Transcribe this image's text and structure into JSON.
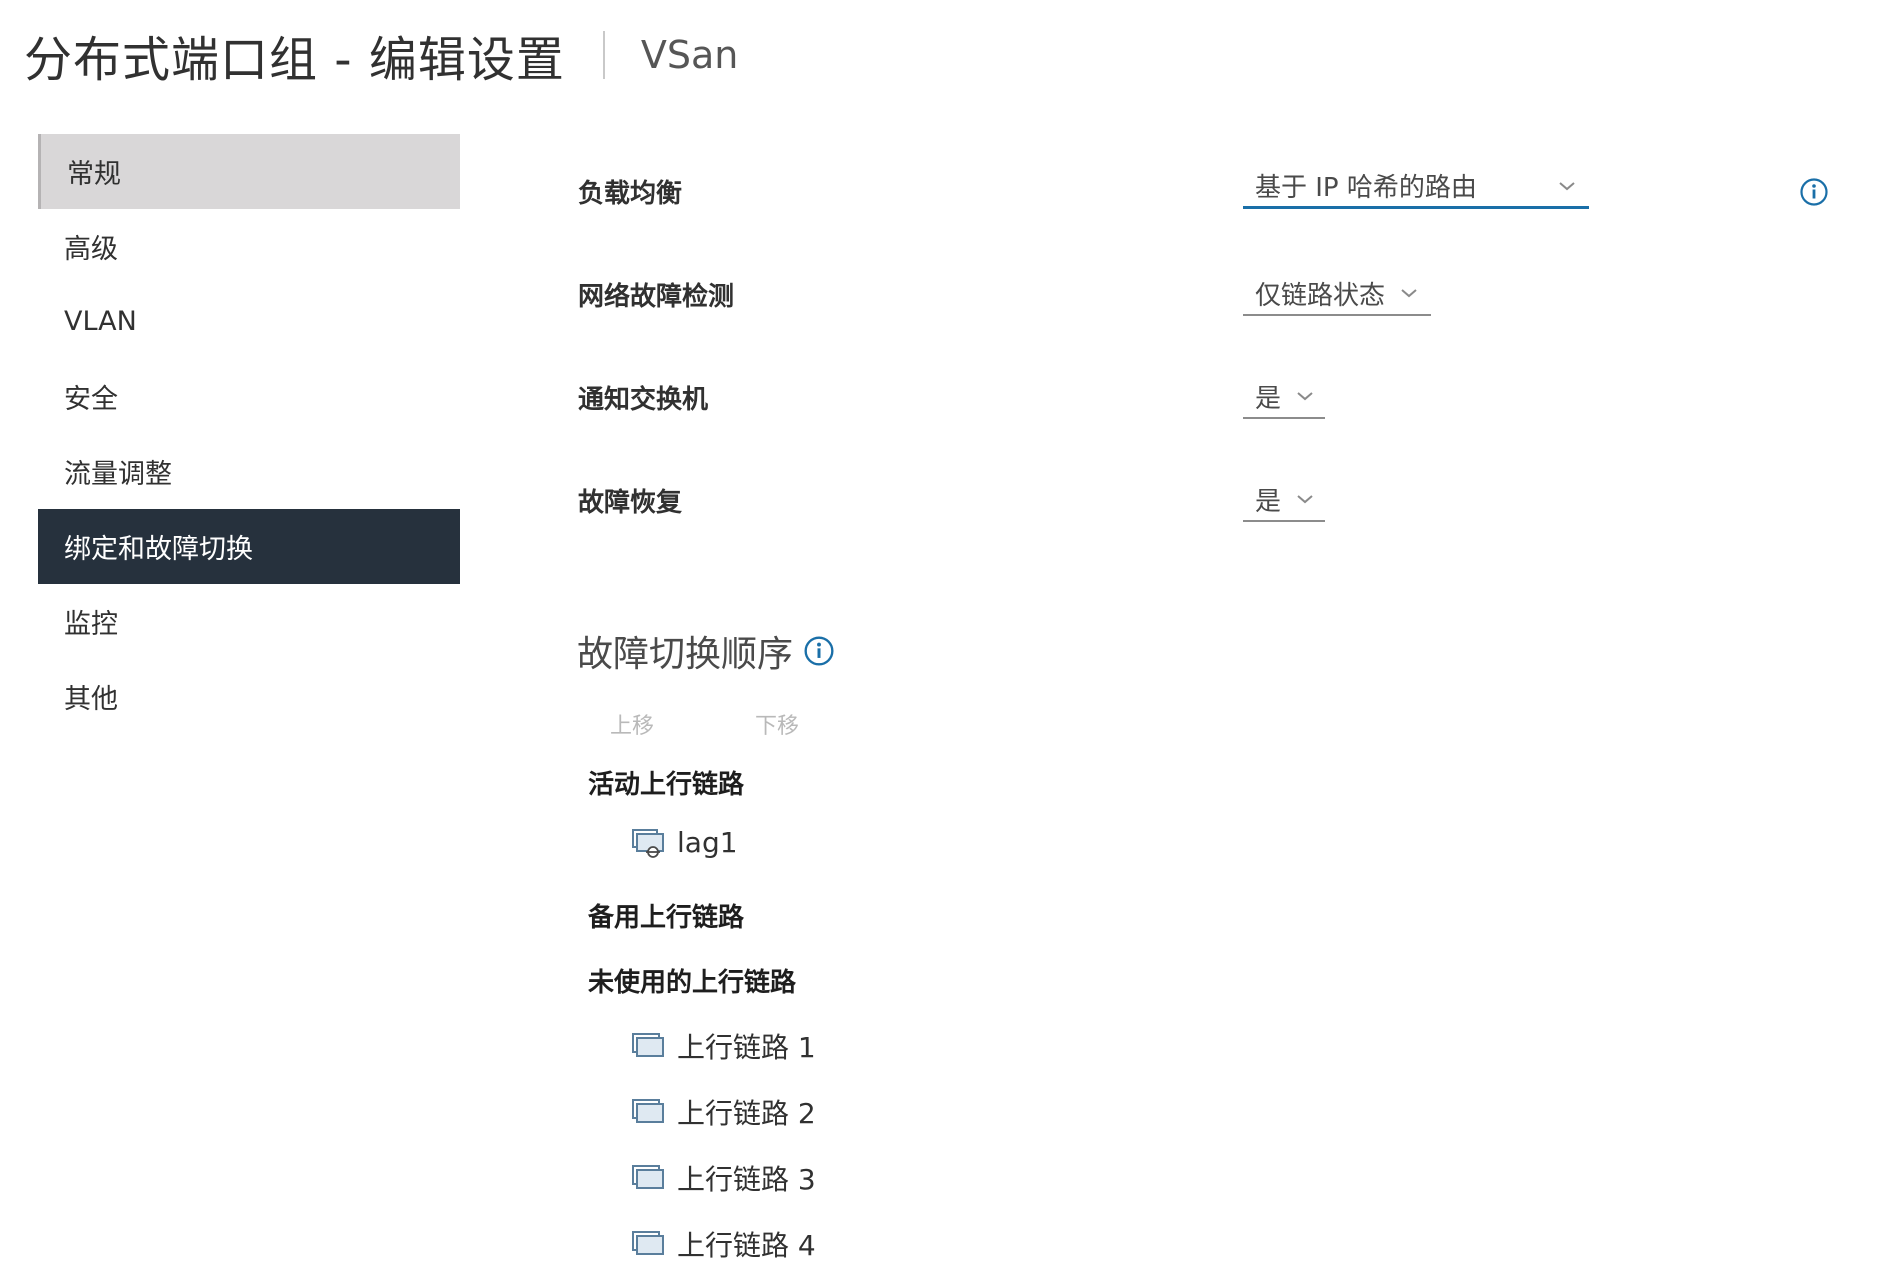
{
  "header": {
    "title": "分布式端口组 - 编辑设置",
    "subtitle": "VSan"
  },
  "sidebar": {
    "items": [
      {
        "label": "常规"
      },
      {
        "label": "高级"
      },
      {
        "label": "VLAN"
      },
      {
        "label": "安全"
      },
      {
        "label": "流量调整"
      },
      {
        "label": "绑定和故障切换"
      },
      {
        "label": "监控"
      },
      {
        "label": "其他"
      }
    ]
  },
  "form": {
    "load_balancing": {
      "label": "负载均衡",
      "value": "基于 IP 哈希的路由"
    },
    "network_failure_detection": {
      "label": "网络故障检测",
      "value": "仅链路状态"
    },
    "notify_switches": {
      "label": "通知交换机",
      "value": "是"
    },
    "failback": {
      "label": "故障恢复",
      "value": "是"
    }
  },
  "failover": {
    "title": "故障切换顺序",
    "move_up": "上移",
    "move_down": "下移",
    "active_label": "活动上行链路",
    "active": [
      "lag1"
    ],
    "standby_label": "备用上行链路",
    "unused_label": "未使用的上行链路",
    "unused": [
      "上行链路 1",
      "上行链路 2",
      "上行链路 3",
      "上行链路 4"
    ]
  },
  "colors": {
    "accent": "#1a6fa8",
    "nav_active_bg": "#26313d",
    "nav_selected_bg": "#d9d7d8"
  }
}
